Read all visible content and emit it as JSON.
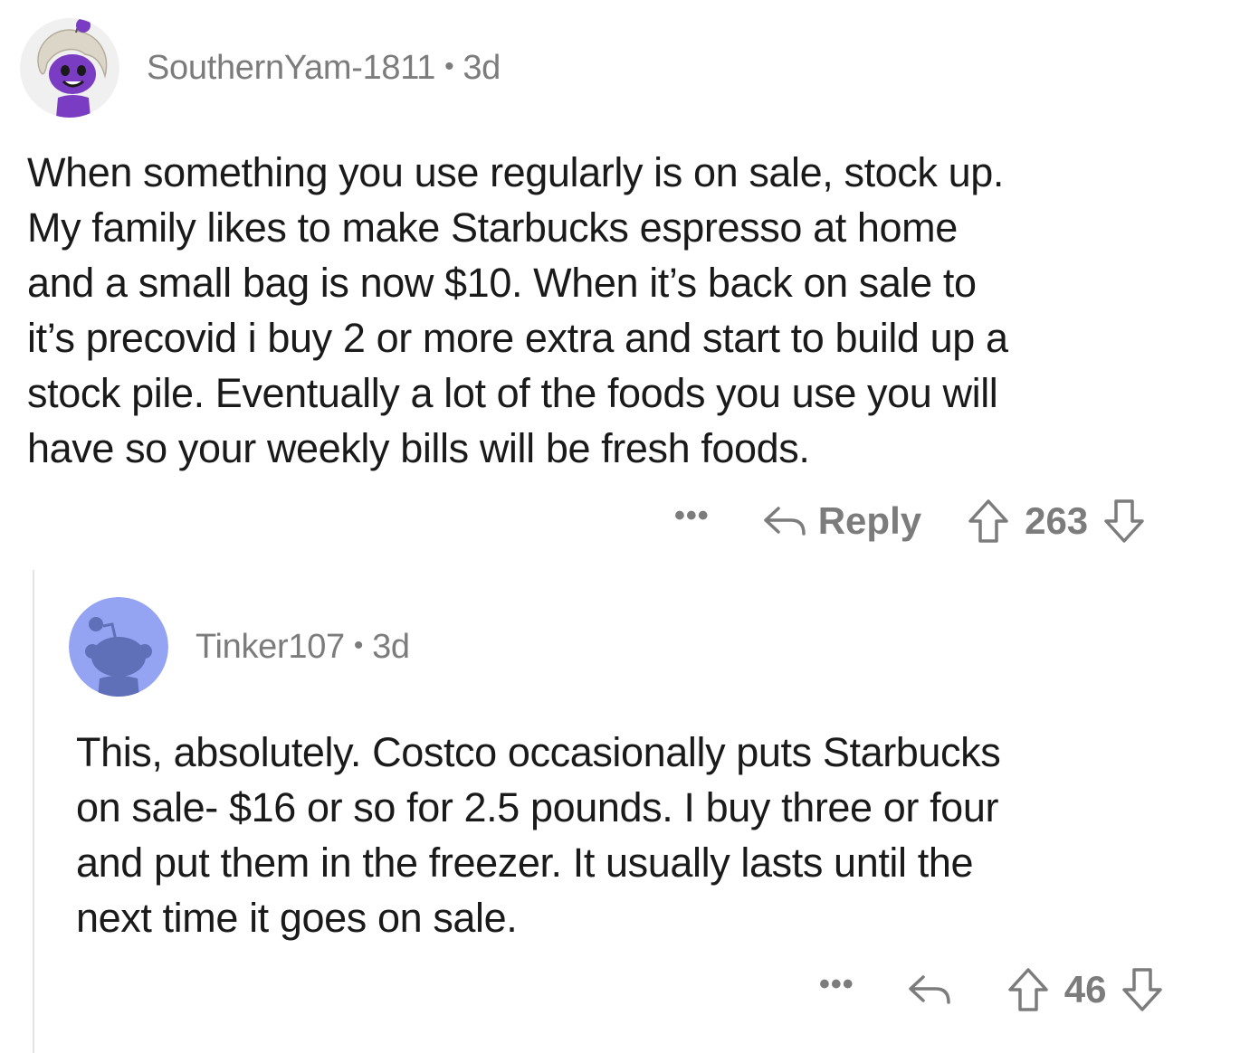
{
  "comments": [
    {
      "username": "SouthernYam-1811",
      "separator": "•",
      "age": "3d",
      "lines": [
        "When something you use regularly is on sale, stock up.",
        "My family likes to make Starbucks espresso at home",
        "and a small bag is now $10. When it’s back on sale to",
        "it’s precovid i buy 2 or more extra and start to build up a",
        "stock pile. Eventually a lot of the foods you use you will",
        "have so your weekly bills will be fresh foods."
      ],
      "more_label": "•••",
      "reply_label": "Reply",
      "score": "263",
      "avatar_icon": "snoo-avatar-purple-icon"
    },
    {
      "username": "Tinker107",
      "separator": "•",
      "age": "3d",
      "lines": [
        "This, absolutely. Costco occasionally puts Starbucks",
        "on sale- $16 or so for 2.5 pounds. I buy three or four",
        "and put them in the freezer. It usually lasts until the",
        "next time it goes on sale."
      ],
      "more_label": "•••",
      "score": "46",
      "avatar_icon": "default-snoo-avatar-icon"
    }
  ],
  "colors": {
    "meta_text": "#7c7c7c",
    "body_text": "#1a1a1b",
    "thread_line": "#e4e4e4",
    "avatar1_bg": "#f2f2f2",
    "avatar1_character": "#7a3cc2",
    "avatar2_bg": "#94a3f2",
    "avatar2_character": "#5f6fb8"
  }
}
